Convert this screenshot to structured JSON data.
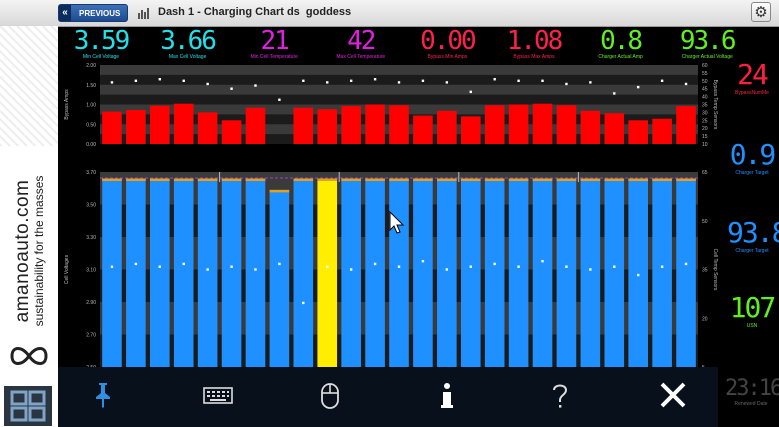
{
  "topbar": {
    "back_label": "PREVIOUS",
    "title": "Dash 1 - Charging Chart ds  goddess"
  },
  "banner": {
    "brand_name": "amanoauto.com",
    "tagline": "sustainability for the masses"
  },
  "readouts": [
    {
      "value": "3.59",
      "label": "Min Cell Voltage",
      "color": "#22e0e8"
    },
    {
      "value": "3.66",
      "label": "Max Cell Voltage",
      "color": "#22e0e8"
    },
    {
      "value": "21",
      "label": "Min Cell Temperature",
      "color": "#e020e0"
    },
    {
      "value": "42",
      "label": "Max Cell Temperature",
      "color": "#e020e0"
    },
    {
      "value": "0.00",
      "label": "Bypass Min Amps",
      "color": "#ff2050"
    },
    {
      "value": "1.08",
      "label": "Bypass Max Amps",
      "color": "#ff2050"
    },
    {
      "value": "0.8",
      "label": "Charger Actual Amp",
      "color": "#60f020"
    },
    {
      "value": "93.6",
      "label": "Charger Actual Voltage",
      "color": "#60f020"
    }
  ],
  "right_panel": [
    {
      "value": "24",
      "label": "BypassNumMe",
      "color": "#ff2040"
    },
    {
      "value": "0.9",
      "label": "Charger Target",
      "color": "#2090ff"
    },
    {
      "value": "93.8",
      "label": "Charger Target",
      "color": "#2090ff"
    },
    {
      "value": "107",
      "label": "USN",
      "color": "#60f020"
    }
  ],
  "clock": {
    "value": "23:16",
    "label": "Renewed Date"
  },
  "chart_data": [
    {
      "type": "bar",
      "ylabel": "Bypass Amps",
      "ylabel_right": "Bypass Temp Sensors",
      "ylim": [
        0,
        2.0
      ],
      "yticks": [
        "2.00",
        "1.50",
        "1.00",
        "0.50",
        "0.00"
      ],
      "yticks_right": [
        "60",
        "55",
        "50",
        "45",
        "40",
        "35",
        "30",
        "25",
        "20",
        "15",
        "10"
      ],
      "y2lim": [
        10,
        60
      ],
      "values": [
        0.82,
        0.86,
        0.97,
        1.02,
        0.8,
        0.6,
        0.92,
        0.0,
        0.92,
        0.88,
        0.96,
        1.0,
        0.98,
        0.72,
        0.84,
        0.7,
        0.98,
        1.0,
        1.02,
        0.98,
        0.84,
        0.78,
        0.6,
        0.64,
        0.96
      ],
      "temps": [
        49,
        50,
        51,
        50,
        48,
        45,
        47,
        38,
        50,
        49,
        50,
        51,
        49,
        50,
        49,
        43,
        51,
        50,
        50,
        48,
        49,
        42,
        46,
        50,
        48
      ],
      "bar_color": "#ff0000"
    },
    {
      "type": "bar",
      "ylabel": "Cell Voltages",
      "ylabel_right": "Cell Temp Sensors",
      "ylim": [
        2.5,
        3.7
      ],
      "yticks": [
        "3.70",
        "3.50",
        "3.30",
        "3.10",
        "2.90",
        "2.70",
        "2.50"
      ],
      "yticks_right": [
        "65",
        "50",
        "35",
        "20",
        "5"
      ],
      "y2lim": [
        0,
        70
      ],
      "values": [
        3.66,
        3.66,
        3.66,
        3.66,
        3.66,
        3.66,
        3.66,
        3.59,
        3.66,
        3.66,
        3.66,
        3.66,
        3.66,
        3.66,
        3.66,
        3.66,
        3.66,
        3.66,
        3.66,
        3.66,
        3.66,
        3.66,
        3.66,
        3.66,
        3.66
      ],
      "highlight_index": 9,
      "temps": [
        36,
        37,
        36,
        37,
        35,
        36,
        35,
        37,
        23,
        36,
        35,
        37,
        36,
        38,
        35,
        36,
        37,
        36,
        38,
        36,
        35,
        36,
        33,
        36,
        37
      ],
      "bar_color": "#1e90ff",
      "highlight_color": "#ffee00",
      "cap_color": "#e0a020"
    }
  ],
  "toolbar": {
    "items": [
      "pin",
      "keyboard",
      "mouse",
      "info",
      "help",
      "close"
    ]
  }
}
